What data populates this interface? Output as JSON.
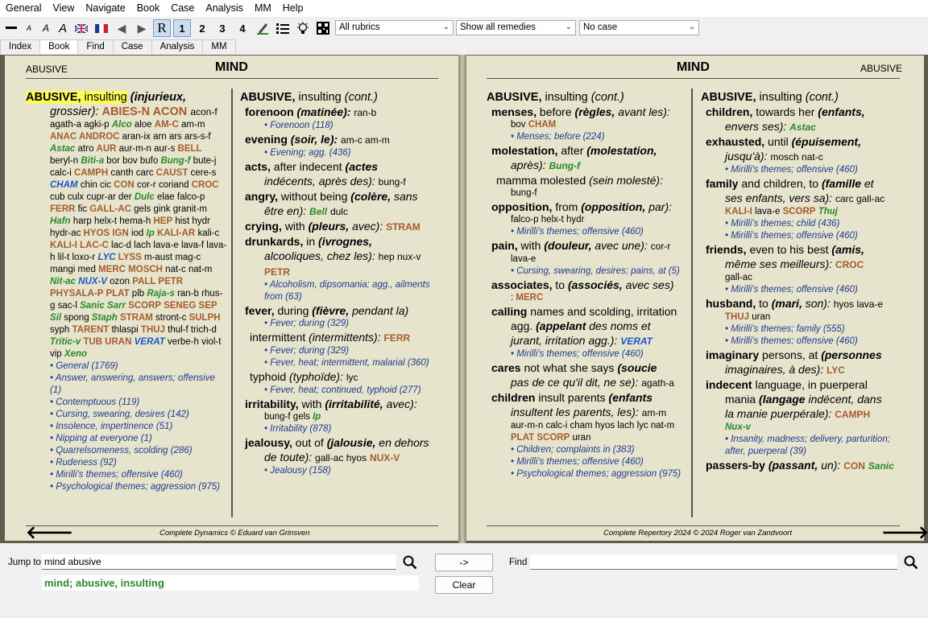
{
  "menu": [
    "General",
    "View",
    "Navigate",
    "Book",
    "Case",
    "Analysis",
    "MM",
    "Help"
  ],
  "toolbar": {
    "rubrics": "All rubrics",
    "remedies": "Show all remedies",
    "case": "No case",
    "r_btn": "R",
    "n1": "1",
    "n2": "2",
    "n3": "3",
    "n4": "4"
  },
  "tabs": [
    "Index",
    "Book",
    "Find",
    "Case",
    "Analysis",
    "MM"
  ],
  "left_page": {
    "corner": "ABUSIVE",
    "title": "MIND",
    "footer": "Complete Dynamics © Eduard van Grinsven"
  },
  "right_page": {
    "corner": "ABUSIVE",
    "title": "MIND",
    "footer": "Complete Repertory 2024 © 2024 Roger van Zandvoort"
  },
  "bottom": {
    "jump_label": "Jump to",
    "jump_value": "mind abusive",
    "result_a": "mind;",
    "result_b": "abusive, insulting",
    "go": "->",
    "clear": "Clear",
    "find_label": "Find"
  },
  "colors": {
    "accent": "#a55c2c",
    "green": "#2a8a2a",
    "blue": "#1a56c7",
    "page": "#e6e4cd"
  }
}
